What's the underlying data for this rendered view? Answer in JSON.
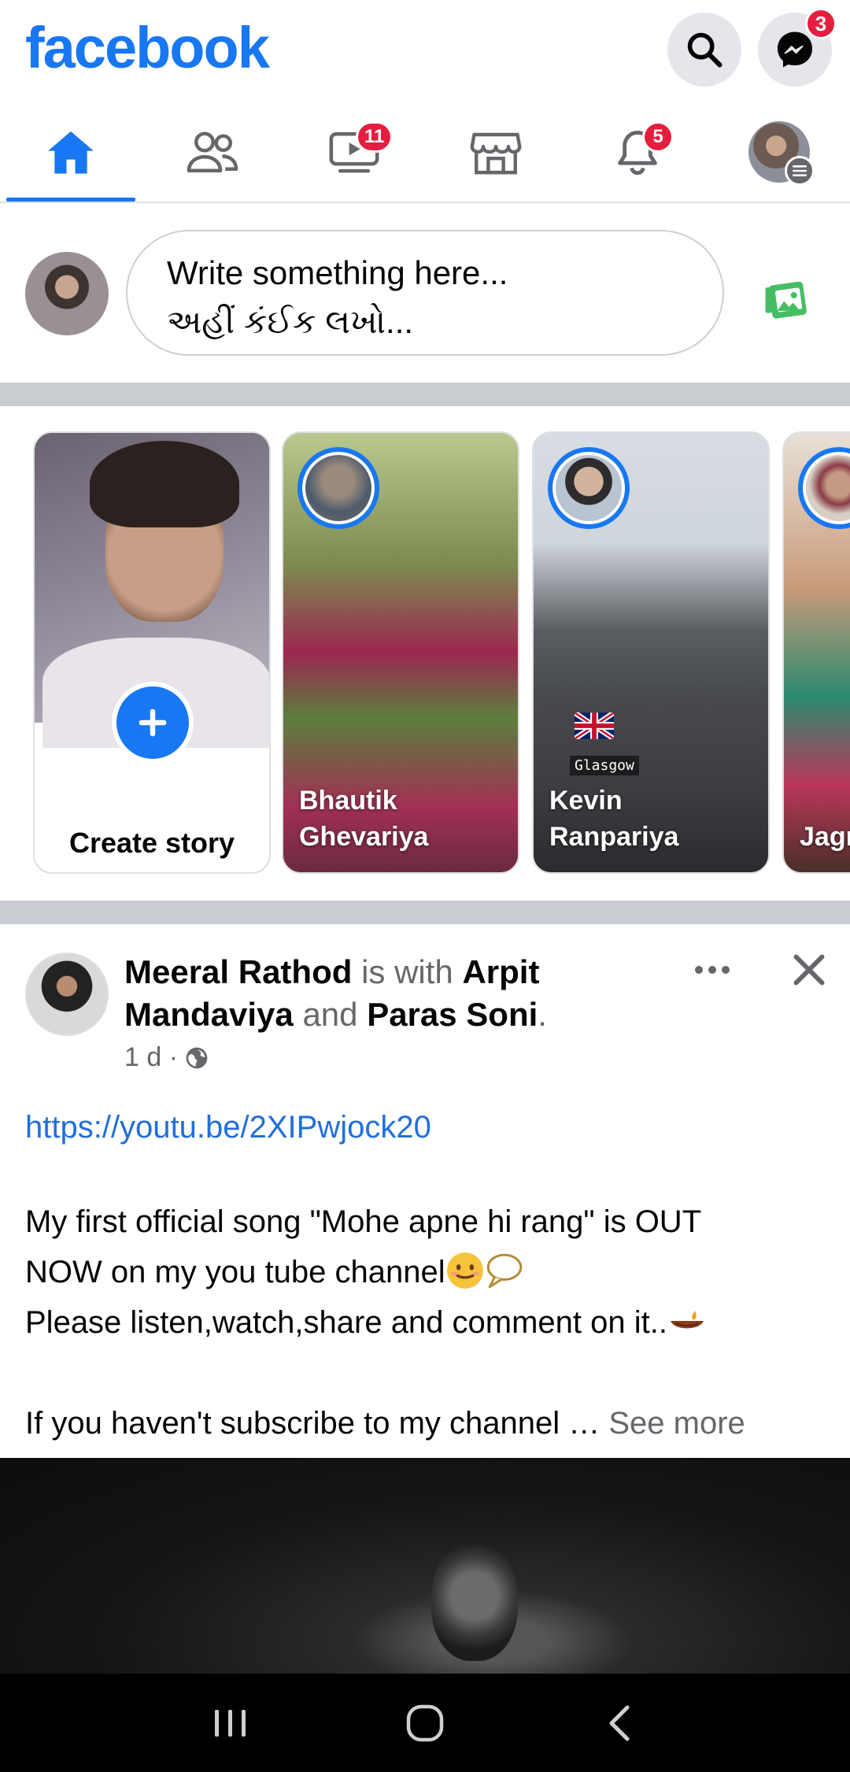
{
  "header": {
    "logo": "facebook",
    "messenger_badge": "3",
    "colors": {
      "brand": "#1877f2",
      "badge": "#e41e3f"
    }
  },
  "tabs": [
    {
      "name": "home",
      "icon": "home-icon",
      "active": true,
      "badge": ""
    },
    {
      "name": "friends",
      "icon": "friends-icon",
      "active": false,
      "badge": ""
    },
    {
      "name": "watch",
      "icon": "video-icon",
      "active": false,
      "badge": "11"
    },
    {
      "name": "marketplace",
      "icon": "marketplace-icon",
      "active": false,
      "badge": ""
    },
    {
      "name": "notifications",
      "icon": "bell-icon",
      "active": false,
      "badge": "5"
    },
    {
      "name": "menu",
      "icon": "profile-menu-icon",
      "active": false,
      "badge": ""
    }
  ],
  "composer": {
    "line1": "Write something here...",
    "line2": "અહીં કંઈક લખો..."
  },
  "stories": [
    {
      "label": "Create story"
    },
    {
      "name": "Bhautik Ghevariya"
    },
    {
      "name": "Kevin Ranpariya",
      "sticker": "Glasgow"
    },
    {
      "name": "Jagr Gon"
    }
  ],
  "post": {
    "author": "Meeral Rathod",
    "is_with": "is with",
    "friend1": "Arpit Mandaviya",
    "and": "and",
    "friend2": "Paras Soni",
    "period": ".",
    "time": "1 d ·",
    "link": "https://youtu.be/2XIPwjock20",
    "line1": "My first official song \"Mohe apne hi rang\" is OUT",
    "line2": "NOW on my you tube channel",
    "line3": "Please listen,watch,share and comment on it..",
    "line4": "If you haven't subscribe to my channel …",
    "see_more": "See more"
  }
}
